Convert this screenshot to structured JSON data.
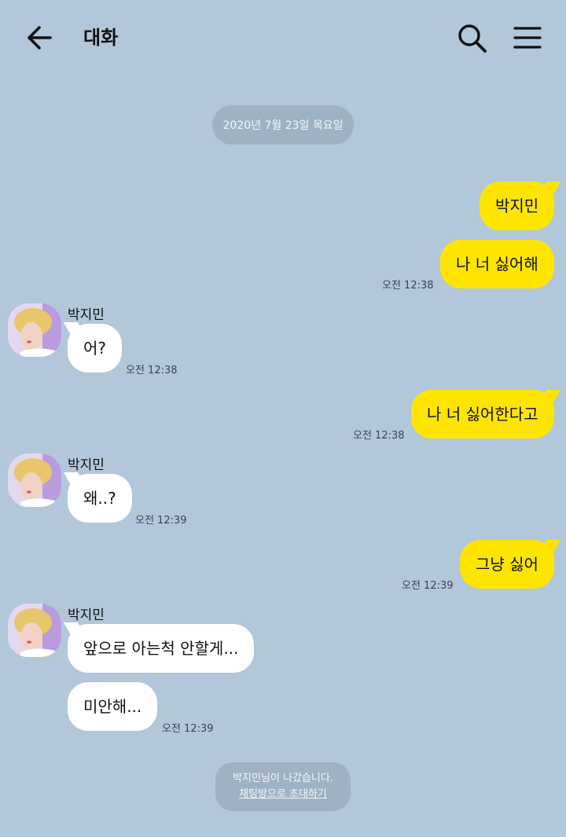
{
  "header": {
    "title": "대화"
  },
  "date_divider": "2020년 7월 23일 목요일",
  "contact": {
    "name": "박지민"
  },
  "messages": [
    {
      "from": "me",
      "text": "박지민",
      "time": ""
    },
    {
      "from": "me",
      "text": "나 너 싫어해",
      "time": "오전 12:38"
    },
    {
      "from": "them",
      "text": "어?",
      "time": "오전 12:38",
      "sender": "박지민"
    },
    {
      "from": "me",
      "text": "나 너 싫어한다고",
      "time": "오전 12:38"
    },
    {
      "from": "them",
      "text": "왜..?",
      "time": "오전 12:39",
      "sender": "박지민"
    },
    {
      "from": "me",
      "text": "그냥 싫어",
      "time": "오전 12:39"
    },
    {
      "from": "them",
      "text": "앞으로 아는척 안할게...",
      "time": "",
      "sender": "박지민"
    },
    {
      "from": "them",
      "text": "미안해...",
      "time": "오전 12:39"
    }
  ],
  "system_notice": {
    "text": "박지민님이 나갔습니다.",
    "link": "채팅방으로 초대하기"
  },
  "colors": {
    "background": "#b2c7d9",
    "my_bubble": "#fee500",
    "their_bubble": "#ffffff",
    "chip": "#9fb2c3"
  }
}
